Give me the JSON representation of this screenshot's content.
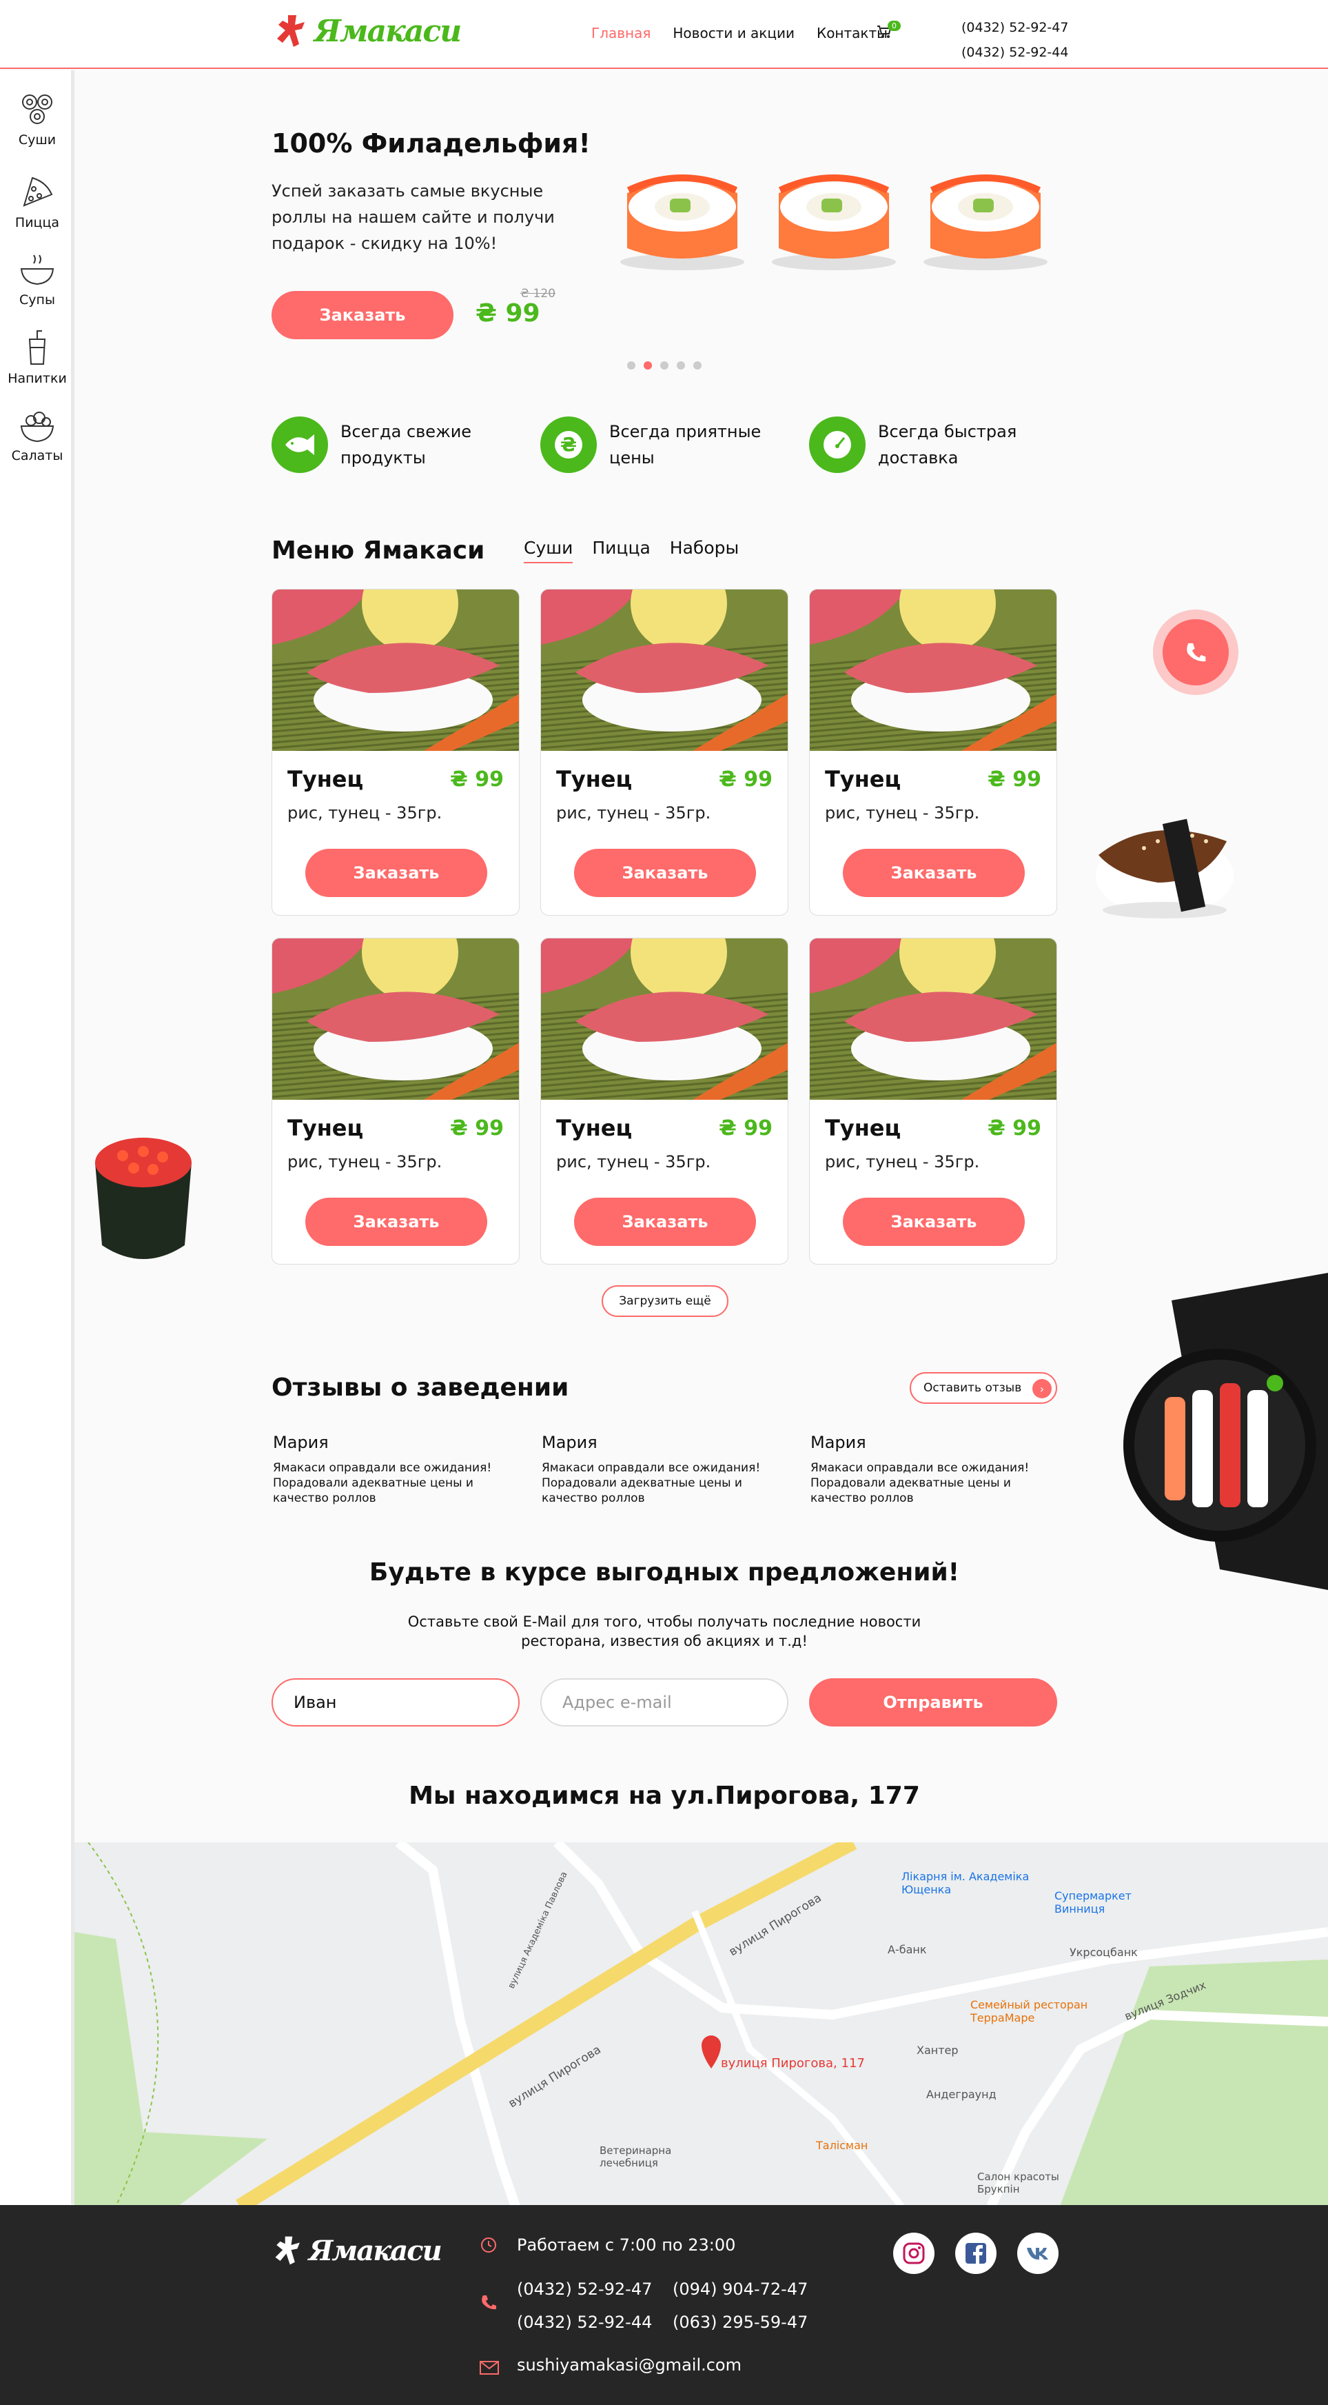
{
  "header": {
    "logo_text": "Ямакаси",
    "nav": [
      {
        "label": "Главная",
        "active": true
      },
      {
        "label": "Новости и акции"
      },
      {
        "label": "Контакты"
      }
    ],
    "cart_count": "0",
    "phones": [
      "(0432) 52-92-47",
      "(0432) 52-92-44"
    ]
  },
  "sidebar": [
    {
      "label": "Суши",
      "icon": "sushi-icon"
    },
    {
      "label": "Пицца",
      "icon": "pizza-icon"
    },
    {
      "label": "Супы",
      "icon": "soup-icon"
    },
    {
      "label": "Напитки",
      "icon": "drink-icon"
    },
    {
      "label": "Салаты",
      "icon": "salad-icon"
    }
  ],
  "hero": {
    "title": "100% Филадельфия!",
    "text": "Успей заказать самые вкусные роллы на нашем сайте и получи подарок - скидку на 10%!",
    "button": "Заказать",
    "price": "₴ 99",
    "old_price": "₴ 120",
    "slides": 5,
    "active_slide": 2
  },
  "features": [
    {
      "text": "Всегда свежие продукты",
      "icon": "fish-icon"
    },
    {
      "text": "Всегда приятные цены",
      "icon": "hryvnia-icon"
    },
    {
      "text": "Всегда быстрая доставка",
      "icon": "speedometer-icon"
    }
  ],
  "menu": {
    "title": "Меню Ямакаси",
    "tabs": [
      {
        "label": "Суши",
        "active": true
      },
      {
        "label": "Пицца"
      },
      {
        "label": "Наборы"
      }
    ],
    "items": [
      {
        "name": "Тунец",
        "price": "₴ 99",
        "desc": "рис, тунец - 35гр.",
        "button": "Заказать"
      },
      {
        "name": "Тунец",
        "price": "₴ 99",
        "desc": "рис, тунец - 35гр.",
        "button": "Заказать"
      },
      {
        "name": "Тунец",
        "price": "₴ 99",
        "desc": "рис, тунец - 35гр.",
        "button": "Заказать"
      },
      {
        "name": "Тунец",
        "price": "₴ 99",
        "desc": "рис, тунец - 35гр.",
        "button": "Заказать"
      },
      {
        "name": "Тунец",
        "price": "₴ 99",
        "desc": "рис, тунец - 35гр.",
        "button": "Заказать"
      },
      {
        "name": "Тунец",
        "price": "₴ 99",
        "desc": "рис, тунец - 35гр.",
        "button": "Заказать"
      }
    ],
    "load_more": "Загрузить ещё"
  },
  "reviews": {
    "title": "Отзывы о заведении",
    "button": "Оставить отзыв",
    "items": [
      {
        "name": "Мария",
        "text": "Ямакаси оправдали все ожидания! Порадовали адекватные цены и качество роллов"
      },
      {
        "name": "Мария",
        "text": "Ямакаси оправдали все ожидания! Порадовали адекватные цены и качество роллов"
      },
      {
        "name": "Мария",
        "text": "Ямакаси оправдали все ожидания! Порадовали адекватные цены и качество роллов"
      }
    ]
  },
  "subscribe": {
    "title": "Будьте в курсе выгодных предложений!",
    "text": "Оставьте свой E-Mail для того, чтобы получать последние новости ресторана, известия об акциях и т.д!",
    "name_value": "Иван",
    "email_placeholder": "Адрес e-mail",
    "button": "Отправить"
  },
  "location": {
    "title": "Мы находимся на ул.Пирогова, 177",
    "map_labels": {
      "marker": "вулиця Пирогова, 117",
      "street1": "вулиця Пирогова",
      "street2": "вулиця Пирогова",
      "street3": "вулиця Зодчих",
      "street4": "вулиця Академіка Павлова",
      "poi1": "Лікарня ім. Академіка Ющенка",
      "poi2": "Супермаркет Винниця",
      "poi3": "А-банк",
      "poi4": "Укрсоцбанк",
      "poi5": "Семейный ресторан ТерраМаре",
      "poi6": "Хантер",
      "poi7": "Андеграунд",
      "poi8": "Талісман",
      "poi9": "Ветеринарна лечебниця",
      "poi10": "Салон красоты Брукпін"
    }
  },
  "footer": {
    "logo_text": "Ямакаси",
    "hours": "Работаем с 7:00 по 23:00",
    "phones": [
      "(0432) 52-92-47",
      "(094) 904-72-47",
      "(0432) 52-92-44",
      "(063) 295-59-47"
    ],
    "email": "sushiyamakasi@gmail.com",
    "socials": [
      "instagram-icon",
      "facebook-icon",
      "vk-icon"
    ]
  },
  "colors": {
    "accent": "#ff6a6a",
    "green": "#4bb81c",
    "footer": "#262626"
  }
}
